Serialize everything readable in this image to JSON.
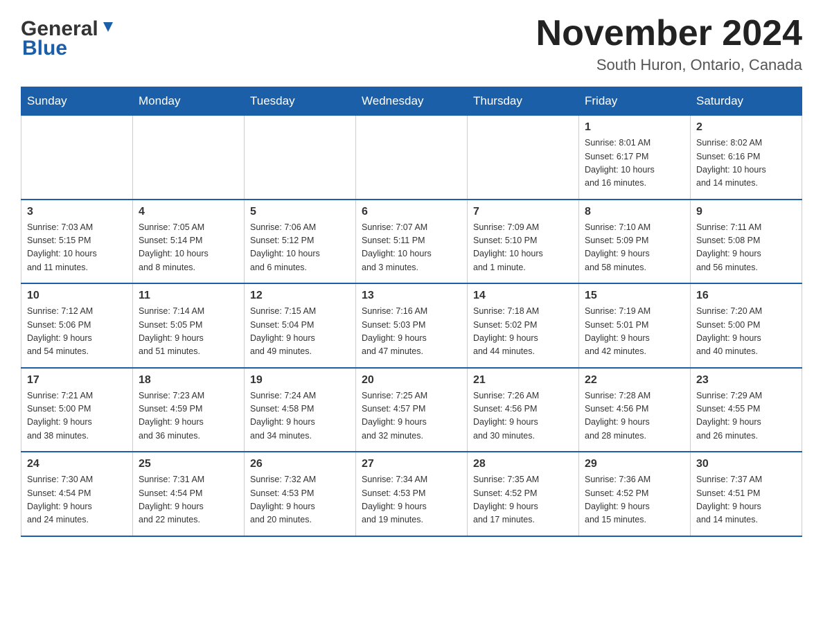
{
  "header": {
    "logo": {
      "general": "General",
      "blue": "Blue"
    },
    "title": "November 2024",
    "subtitle": "South Huron, Ontario, Canada"
  },
  "weekdays": [
    "Sunday",
    "Monday",
    "Tuesday",
    "Wednesday",
    "Thursday",
    "Friday",
    "Saturday"
  ],
  "weeks": [
    {
      "days": [
        {
          "number": "",
          "info": ""
        },
        {
          "number": "",
          "info": ""
        },
        {
          "number": "",
          "info": ""
        },
        {
          "number": "",
          "info": ""
        },
        {
          "number": "",
          "info": ""
        },
        {
          "number": "1",
          "info": "Sunrise: 8:01 AM\nSunset: 6:17 PM\nDaylight: 10 hours\nand 16 minutes."
        },
        {
          "number": "2",
          "info": "Sunrise: 8:02 AM\nSunset: 6:16 PM\nDaylight: 10 hours\nand 14 minutes."
        }
      ]
    },
    {
      "days": [
        {
          "number": "3",
          "info": "Sunrise: 7:03 AM\nSunset: 5:15 PM\nDaylight: 10 hours\nand 11 minutes."
        },
        {
          "number": "4",
          "info": "Sunrise: 7:05 AM\nSunset: 5:14 PM\nDaylight: 10 hours\nand 8 minutes."
        },
        {
          "number": "5",
          "info": "Sunrise: 7:06 AM\nSunset: 5:12 PM\nDaylight: 10 hours\nand 6 minutes."
        },
        {
          "number": "6",
          "info": "Sunrise: 7:07 AM\nSunset: 5:11 PM\nDaylight: 10 hours\nand 3 minutes."
        },
        {
          "number": "7",
          "info": "Sunrise: 7:09 AM\nSunset: 5:10 PM\nDaylight: 10 hours\nand 1 minute."
        },
        {
          "number": "8",
          "info": "Sunrise: 7:10 AM\nSunset: 5:09 PM\nDaylight: 9 hours\nand 58 minutes."
        },
        {
          "number": "9",
          "info": "Sunrise: 7:11 AM\nSunset: 5:08 PM\nDaylight: 9 hours\nand 56 minutes."
        }
      ]
    },
    {
      "days": [
        {
          "number": "10",
          "info": "Sunrise: 7:12 AM\nSunset: 5:06 PM\nDaylight: 9 hours\nand 54 minutes."
        },
        {
          "number": "11",
          "info": "Sunrise: 7:14 AM\nSunset: 5:05 PM\nDaylight: 9 hours\nand 51 minutes."
        },
        {
          "number": "12",
          "info": "Sunrise: 7:15 AM\nSunset: 5:04 PM\nDaylight: 9 hours\nand 49 minutes."
        },
        {
          "number": "13",
          "info": "Sunrise: 7:16 AM\nSunset: 5:03 PM\nDaylight: 9 hours\nand 47 minutes."
        },
        {
          "number": "14",
          "info": "Sunrise: 7:18 AM\nSunset: 5:02 PM\nDaylight: 9 hours\nand 44 minutes."
        },
        {
          "number": "15",
          "info": "Sunrise: 7:19 AM\nSunset: 5:01 PM\nDaylight: 9 hours\nand 42 minutes."
        },
        {
          "number": "16",
          "info": "Sunrise: 7:20 AM\nSunset: 5:00 PM\nDaylight: 9 hours\nand 40 minutes."
        }
      ]
    },
    {
      "days": [
        {
          "number": "17",
          "info": "Sunrise: 7:21 AM\nSunset: 5:00 PM\nDaylight: 9 hours\nand 38 minutes."
        },
        {
          "number": "18",
          "info": "Sunrise: 7:23 AM\nSunset: 4:59 PM\nDaylight: 9 hours\nand 36 minutes."
        },
        {
          "number": "19",
          "info": "Sunrise: 7:24 AM\nSunset: 4:58 PM\nDaylight: 9 hours\nand 34 minutes."
        },
        {
          "number": "20",
          "info": "Sunrise: 7:25 AM\nSunset: 4:57 PM\nDaylight: 9 hours\nand 32 minutes."
        },
        {
          "number": "21",
          "info": "Sunrise: 7:26 AM\nSunset: 4:56 PM\nDaylight: 9 hours\nand 30 minutes."
        },
        {
          "number": "22",
          "info": "Sunrise: 7:28 AM\nSunset: 4:56 PM\nDaylight: 9 hours\nand 28 minutes."
        },
        {
          "number": "23",
          "info": "Sunrise: 7:29 AM\nSunset: 4:55 PM\nDaylight: 9 hours\nand 26 minutes."
        }
      ]
    },
    {
      "days": [
        {
          "number": "24",
          "info": "Sunrise: 7:30 AM\nSunset: 4:54 PM\nDaylight: 9 hours\nand 24 minutes."
        },
        {
          "number": "25",
          "info": "Sunrise: 7:31 AM\nSunset: 4:54 PM\nDaylight: 9 hours\nand 22 minutes."
        },
        {
          "number": "26",
          "info": "Sunrise: 7:32 AM\nSunset: 4:53 PM\nDaylight: 9 hours\nand 20 minutes."
        },
        {
          "number": "27",
          "info": "Sunrise: 7:34 AM\nSunset: 4:53 PM\nDaylight: 9 hours\nand 19 minutes."
        },
        {
          "number": "28",
          "info": "Sunrise: 7:35 AM\nSunset: 4:52 PM\nDaylight: 9 hours\nand 17 minutes."
        },
        {
          "number": "29",
          "info": "Sunrise: 7:36 AM\nSunset: 4:52 PM\nDaylight: 9 hours\nand 15 minutes."
        },
        {
          "number": "30",
          "info": "Sunrise: 7:37 AM\nSunset: 4:51 PM\nDaylight: 9 hours\nand 14 minutes."
        }
      ]
    }
  ]
}
